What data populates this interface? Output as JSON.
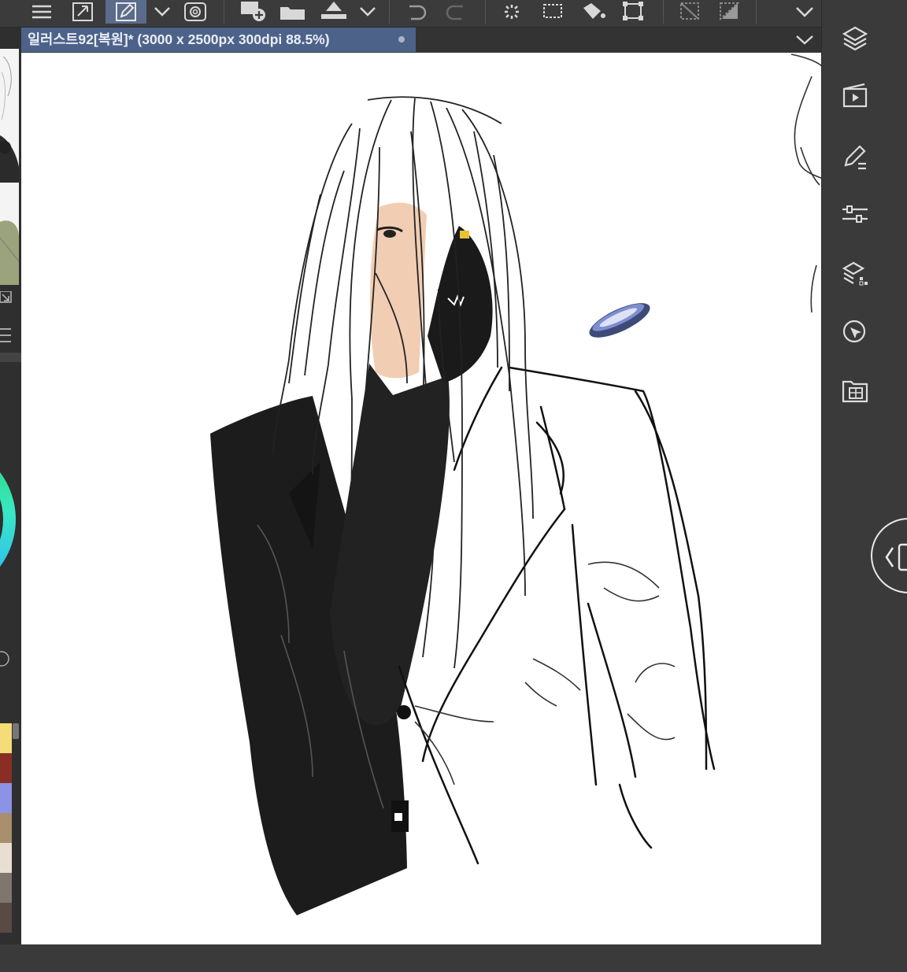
{
  "document": {
    "title": "일러스트92[복원]* (3000 x 2500px 300dpi 88.5%)"
  },
  "toolbar": {
    "buttons": [
      "menu-icon",
      "export-icon",
      "pen-icon",
      "dropdown-icon",
      "spiral-icon",
      "new-layer-icon",
      "open-folder-icon",
      "fill-icon",
      "dropdown-icon",
      "undo-icon",
      "redo-icon",
      "loading-icon",
      "transform-icon",
      "fill-bucket-icon",
      "select-icon",
      "clear-icon",
      "invert-icon",
      "dropdown-icon"
    ]
  },
  "right_panel": {
    "icons": [
      "layers-icon",
      "animation-icon",
      "sub-tool-icon",
      "tool-property-icon",
      "layer-property-icon",
      "navigator-icon",
      "material-icon"
    ]
  },
  "palette": {
    "colors": [
      "#f4dc78",
      "#8a2d25",
      "#8c92e6",
      "#a88f6d",
      "#e8dfd2",
      "#7f766f",
      "#5a4a45"
    ]
  },
  "colors": {
    "toolbar_bg": "#3b3b3b",
    "tab_active": "#4d6289",
    "panel_bg": "#3a3a3a",
    "canvas_bg": "#ffffff"
  }
}
